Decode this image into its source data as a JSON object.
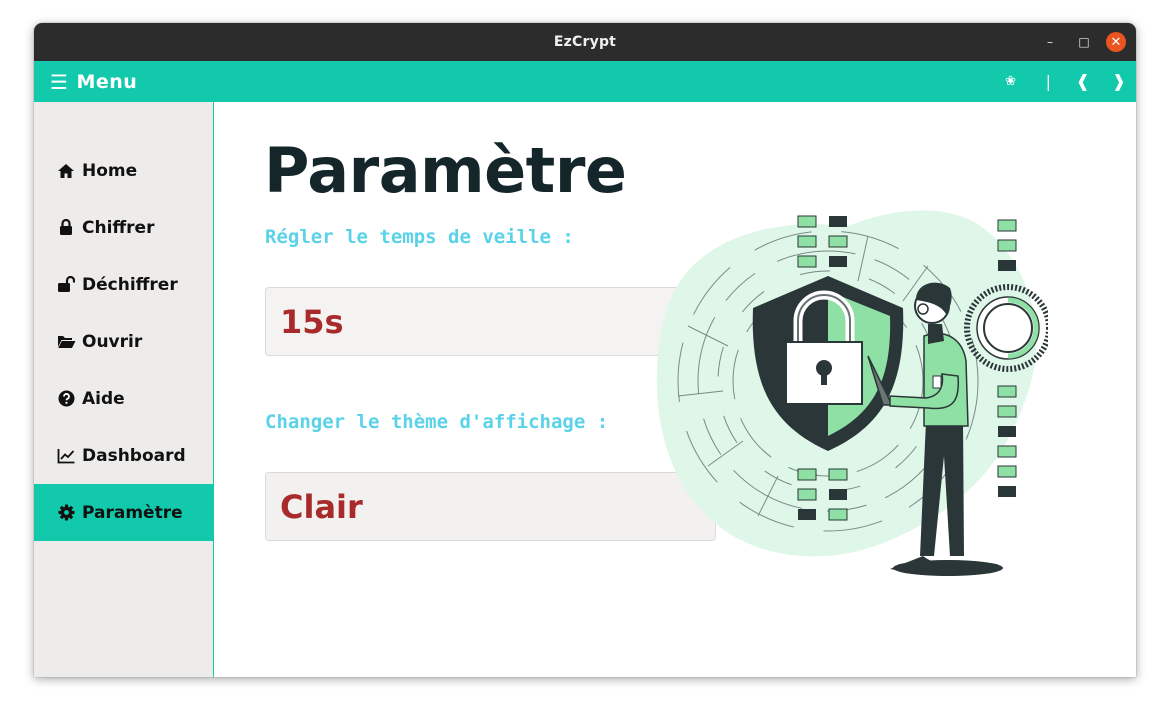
{
  "window": {
    "title": "EzCrypt"
  },
  "window_controls": {
    "minimize": "–",
    "maximize": "□",
    "close": "✕"
  },
  "menubar": {
    "toggle_label": "Menu",
    "burger_glyph": "☰",
    "right_items": {
      "flower": "❀",
      "separator": "|",
      "prev": "❰",
      "next": "❱"
    }
  },
  "sidebar": {
    "items": [
      {
        "label": "Home",
        "icon": "home-icon"
      },
      {
        "label": "Chiffrer",
        "icon": "lock-icon"
      },
      {
        "label": "Déchiffrer",
        "icon": "unlock-icon"
      },
      {
        "label": "Ouvrir",
        "icon": "folder-open-icon"
      },
      {
        "label": "Aide",
        "icon": "question-circle-icon"
      },
      {
        "label": "Dashboard",
        "icon": "line-chart-icon"
      },
      {
        "label": "Paramètre",
        "icon": "gear-icon",
        "active": true
      }
    ]
  },
  "main": {
    "title": "Paramètre",
    "sleep_label": "Régler le temps de veille :",
    "sleep_value": "15s",
    "theme_label": "Changer le thème d'affichage :",
    "theme_value": "Clair"
  },
  "colors": {
    "accent": "#12c9ab",
    "titlebar": "#2c2c2c",
    "sidebar_bg": "#edecea",
    "label": "#5ad2e8",
    "select_value": "#a82a2a",
    "heading": "#14262a",
    "close_button": "#e95420"
  }
}
